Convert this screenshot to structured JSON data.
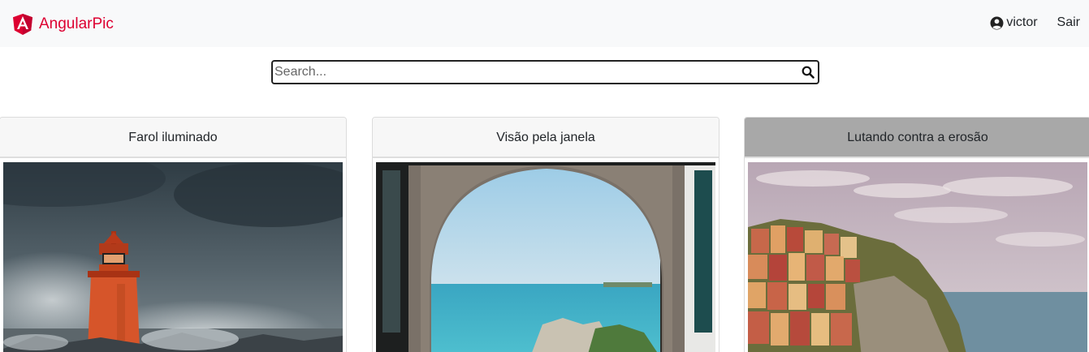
{
  "navbar": {
    "brand": "AngularPic",
    "user": "victor",
    "logout": "Sair"
  },
  "search": {
    "placeholder": "Search..."
  },
  "photos": [
    {
      "title": "Farol iluminado"
    },
    {
      "title": "Visão pela janela"
    },
    {
      "title": "Lutando contra a erosão"
    }
  ],
  "colors": {
    "brand": "#dd0031",
    "navbar_bg": "#f8f9fa",
    "active_header": "#a8a8a8"
  }
}
